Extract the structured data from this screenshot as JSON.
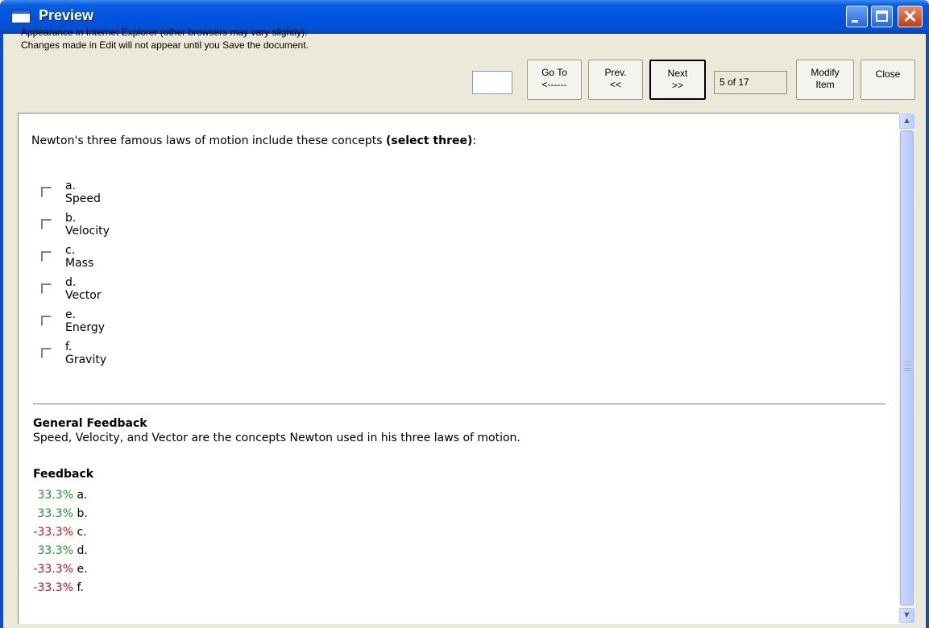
{
  "window": {
    "title": "Preview",
    "buttons": {
      "minimize": "minimize-icon",
      "maximize": "maximize-icon",
      "close": "close-icon"
    }
  },
  "toolbar": {
    "notice_line1": "Appearance in Internet Explorer (other browsers may vary slightly).",
    "notice_line2": "Changes made in Edit will not appear until you Save the document.",
    "goto_value": "",
    "goto_line1": "Go To",
    "goto_line2": "<------",
    "prev_line1": "Prev.",
    "prev_line2": "<<",
    "next_line1": "Next",
    "next_line2": ">>",
    "counter": "5 of 17",
    "modify_line1": "Modify",
    "modify_line2": "Item",
    "close_label": "Close"
  },
  "question": {
    "prompt": "Newton's three famous laws of motion include these concepts ",
    "prompt_emphasis": "(select three)",
    "prompt_suffix": ":",
    "options": [
      {
        "label": "a. Speed",
        "checked": false
      },
      {
        "label": "b. Velocity",
        "checked": false
      },
      {
        "label": "c. Mass",
        "checked": false
      },
      {
        "label": "d. Vector",
        "checked": false
      },
      {
        "label": "e. Energy",
        "checked": false
      },
      {
        "label": "f. Gravity",
        "checked": false
      }
    ]
  },
  "general_feedback": {
    "title": "General Feedback",
    "text": "Speed, Velocity, and Vector are the concepts Newton used in his three laws of motion."
  },
  "feedback": {
    "title": "Feedback",
    "items": [
      {
        "value": "33.3%",
        "letter": "a."
      },
      {
        "value": "33.3%",
        "letter": "b."
      },
      {
        "value": "-33.3%",
        "letter": "c."
      },
      {
        "value": "33.3%",
        "letter": "d."
      },
      {
        "value": "-33.3%",
        "letter": "e."
      },
      {
        "value": "-33.3%",
        "letter": "f."
      }
    ],
    "colors": {
      "positive": "#1e9a1e",
      "negative": "#d01010"
    }
  },
  "scrollbar": {
    "up": "scroll-up-icon",
    "down": "scroll-down-icon"
  }
}
